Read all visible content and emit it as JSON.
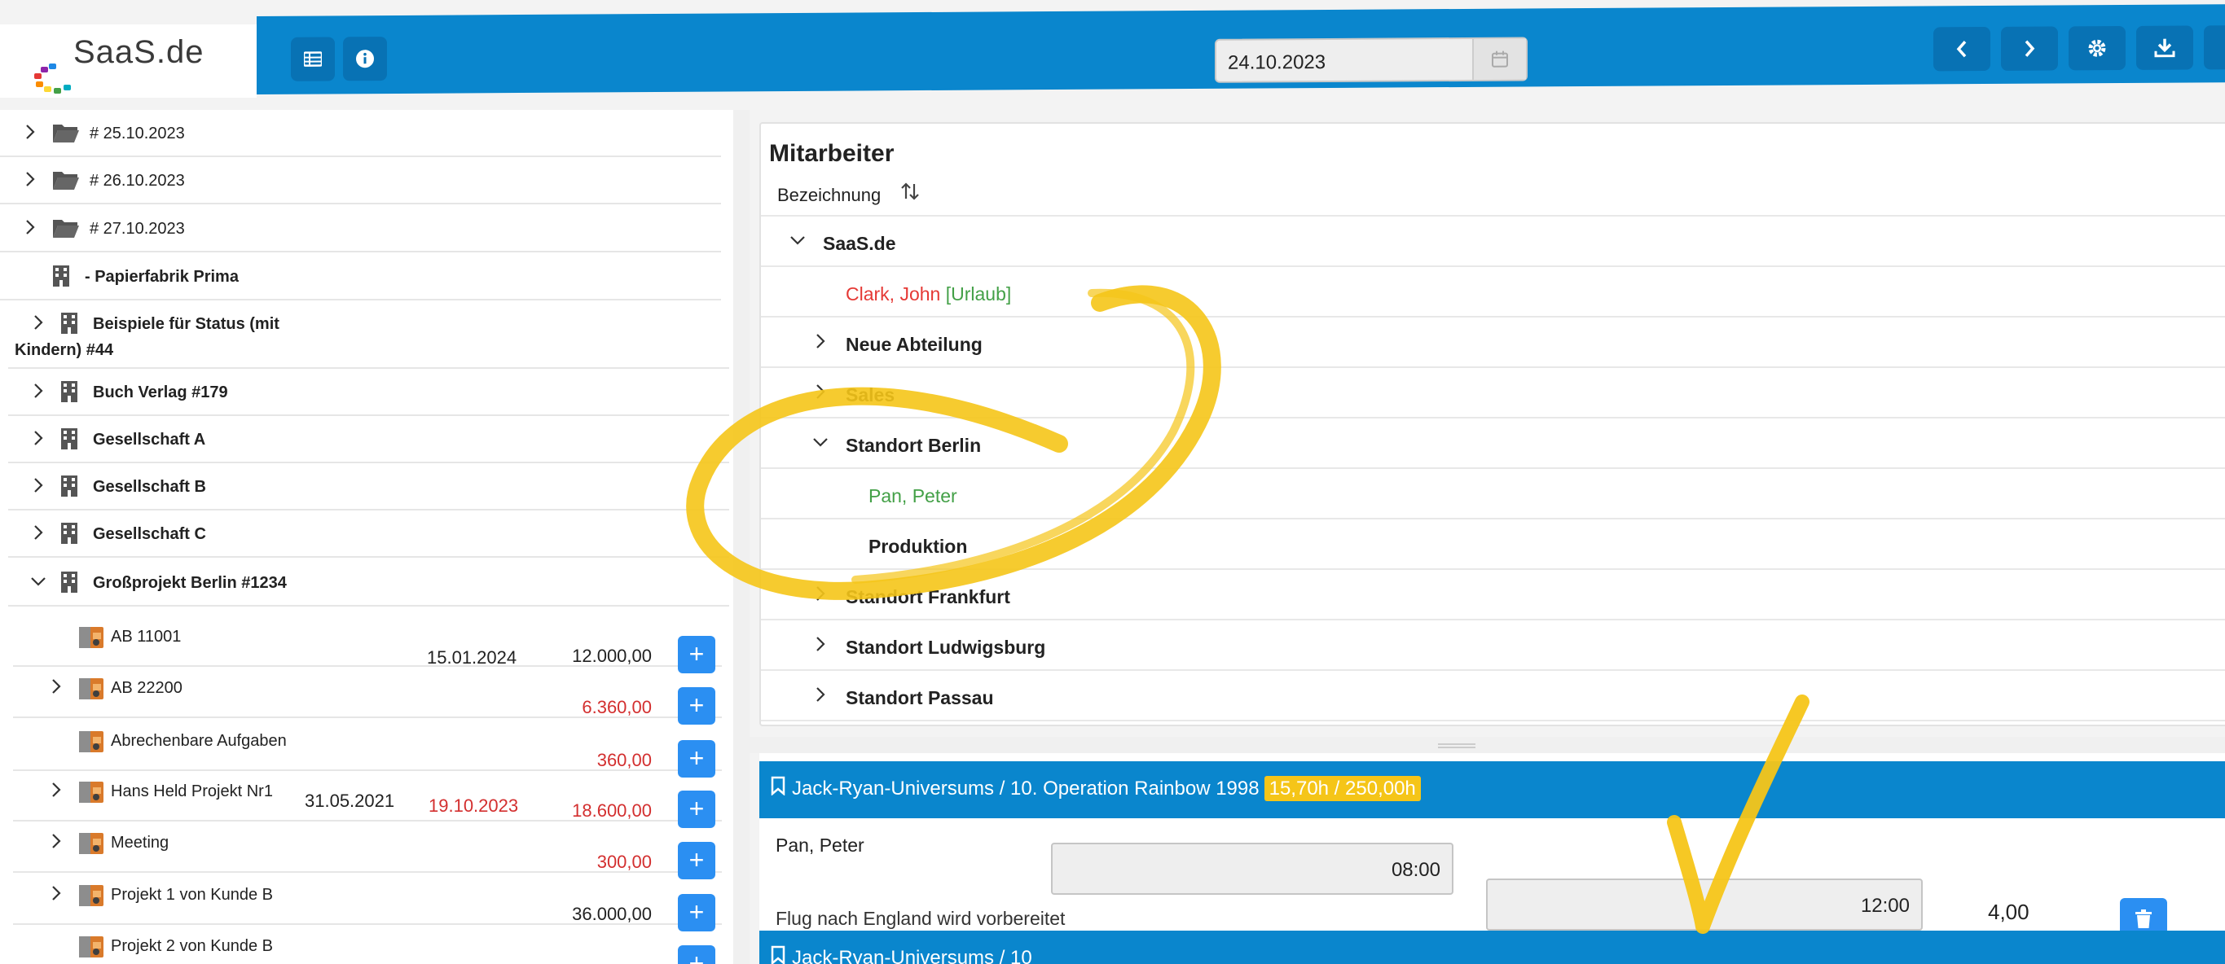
{
  "brand": {
    "name": "SaaS.de"
  },
  "toolbar": {
    "left_icons": [
      "list-icon",
      "info-icon"
    ],
    "date_value": "24.10.2023",
    "calendar_icon": "calendar-icon",
    "right_icons": [
      "chevron-left-icon",
      "chevron-right-icon",
      "gear-icon",
      "download-icon"
    ]
  },
  "tree": {
    "rows": [
      {
        "label": "# 25.10.2023",
        "icon": "folder-open-icon",
        "chevron": ">"
      },
      {
        "label": "# 26.10.2023",
        "icon": "folder-open-icon",
        "chevron": ">"
      },
      {
        "label": "# 27.10.2023",
        "icon": "folder-open-icon",
        "chevron": ">"
      },
      {
        "label": "- Papierfabrik Prima",
        "icon": "building-icon",
        "chevron": ""
      },
      {
        "label": "Beispiele für Status (mit",
        "label2": "Kindern) #44",
        "icon": "building-icon",
        "chevron": ">"
      },
      {
        "label": "Buch Verlag #179",
        "icon": "building-icon",
        "chevron": ">"
      },
      {
        "label": "Gesellschaft A",
        "icon": "building-icon",
        "chevron": ">"
      },
      {
        "label": "Gesellschaft B",
        "icon": "building-icon",
        "chevron": ">"
      },
      {
        "label": "Gesellschaft C",
        "icon": "building-icon",
        "chevron": ">"
      },
      {
        "label": "Großprojekt Berlin #1234",
        "icon": "building-icon",
        "chevron": "v"
      }
    ],
    "projects": [
      {
        "label": "AB 11001",
        "date1": "15.01.2024",
        "date2": "",
        "amount": "12.000,00",
        "amount_red": false,
        "chevron": ""
      },
      {
        "label": "AB 22200",
        "date1": "",
        "date2": "",
        "amount": "6.360,00",
        "amount_red": true,
        "chevron": ">"
      },
      {
        "label": "Abrechenbare Aufgaben",
        "date1": "",
        "date2": "",
        "amount": "360,00",
        "amount_red": true,
        "chevron": ""
      },
      {
        "label": "Hans Held Projekt Nr1",
        "date1": "31.05.2021",
        "date2": "19.10.2023",
        "amount": "18.600,00",
        "amount_red": true,
        "chevron": ">"
      },
      {
        "label": "Meeting",
        "date1": "",
        "date2": "",
        "amount": "300,00",
        "amount_red": true,
        "chevron": ">"
      },
      {
        "label": "Projekt 1 von Kunde B",
        "date1": "",
        "date2": "",
        "amount": "36.000,00",
        "amount_red": false,
        "chevron": ">"
      },
      {
        "label": "Projekt 2 von Kunde B",
        "date1": "",
        "date2": "",
        "amount": "",
        "amount_red": false,
        "chevron": ""
      }
    ],
    "plus_label": "+"
  },
  "mitarbeiter": {
    "title": "Mitarbeiter",
    "column": "Bezeichnung",
    "sort_icon": "sort-icon",
    "rows": [
      {
        "label": "SaaS.de",
        "bold": true,
        "chevron": "v",
        "color": "#222222"
      },
      {
        "label": "Clark, John",
        "suffix": "[Urlaub]",
        "bold": false,
        "chevron": "",
        "color": "#e53935",
        "suffix_color": "#43a047"
      },
      {
        "label": "Neue Abteilung",
        "bold": true,
        "chevron": ">",
        "color": "#222222"
      },
      {
        "label": "Sales",
        "bold": true,
        "chevron": ">",
        "color": "#222222"
      },
      {
        "label": "Standort Berlin",
        "bold": true,
        "chevron": "v",
        "color": "#222222"
      },
      {
        "label": "Pan, Peter",
        "bold": false,
        "chevron": "",
        "color": "#43a047"
      },
      {
        "label": "Produktion",
        "bold": true,
        "chevron": "",
        "color": "#222222"
      },
      {
        "label": "Standort Frankfurt",
        "bold": true,
        "chevron": ">",
        "color": "#222222"
      },
      {
        "label": "Standort Ludwigsburg",
        "bold": true,
        "chevron": ">",
        "color": "#222222"
      },
      {
        "label": "Standort Passau",
        "bold": true,
        "chevron": ">",
        "color": "#222222"
      }
    ]
  },
  "booking": {
    "header_title": "Jack-Ryan-Universums / 10. Operation Rainbow 1998",
    "header_hours": "15,70h / 250,00h",
    "bookmark_icon": "bookmark-icon",
    "employee": "Pan, Peter",
    "note": "Flug nach England wird vorbereitet",
    "start": "08:00",
    "end": "12:00",
    "duration": "4,00",
    "delete_icon": "trash-icon",
    "next_header_title": "Jack-Ryan-Universums / 10"
  },
  "colors": {
    "accent": "#0a86cd",
    "button": "#2b8ff2",
    "marker": "#f5c518",
    "red": "#d32f2f",
    "green": "#43a047"
  }
}
